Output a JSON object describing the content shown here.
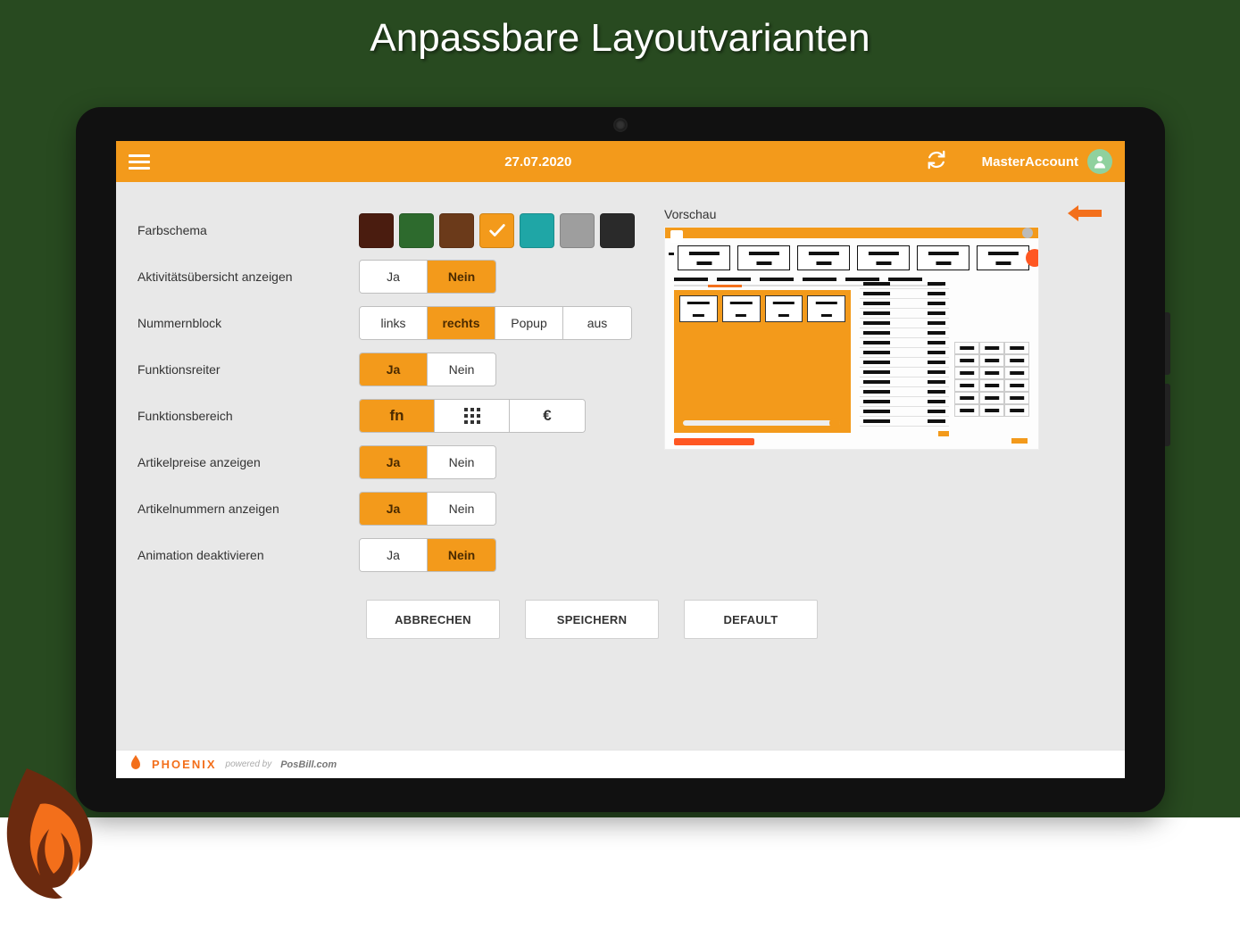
{
  "marketing": {
    "headline": "Anpassbare Layoutvarianten"
  },
  "topbar": {
    "date": "27.07.2020",
    "account": "MasterAccount"
  },
  "settings": {
    "color_scheme": {
      "label": "Farbschema",
      "swatches": [
        "#4a1c0f",
        "#2d6a2d",
        "#6b3a1a",
        "#f39a1b",
        "#1fa6a6",
        "#9e9e9e",
        "#2a2a2a"
      ],
      "selected_index": 3
    },
    "activity_overview": {
      "label": "Aktivitätsübersicht anzeigen",
      "options": [
        "Ja",
        "Nein"
      ],
      "selected_index": 1
    },
    "numpad": {
      "label": "Nummernblock",
      "options": [
        "links",
        "rechts",
        "Popup",
        "aus"
      ],
      "selected_index": 1
    },
    "function_tabs": {
      "label": "Funktionsreiter",
      "options": [
        "Ja",
        "Nein"
      ],
      "selected_index": 0
    },
    "function_area": {
      "label": "Funktionsbereich",
      "options": [
        "fn",
        "grid-icon",
        "€"
      ],
      "selected_index": 0
    },
    "show_prices": {
      "label": "Artikelpreise anzeigen",
      "options": [
        "Ja",
        "Nein"
      ],
      "selected_index": 0
    },
    "show_numbers": {
      "label": "Artikelnummern anzeigen",
      "options": [
        "Ja",
        "Nein"
      ],
      "selected_index": 0
    },
    "disable_animation": {
      "label": "Animation deaktivieren",
      "options": [
        "Ja",
        "Nein"
      ],
      "selected_index": 1
    }
  },
  "preview": {
    "label": "Vorschau"
  },
  "actions": {
    "cancel": "ABBRECHEN",
    "save": "SPEICHERN",
    "default": "DEFAULT"
  },
  "footer": {
    "brand": "PHOENIX",
    "powered_by": "powered by",
    "company": "PosBill.com"
  }
}
